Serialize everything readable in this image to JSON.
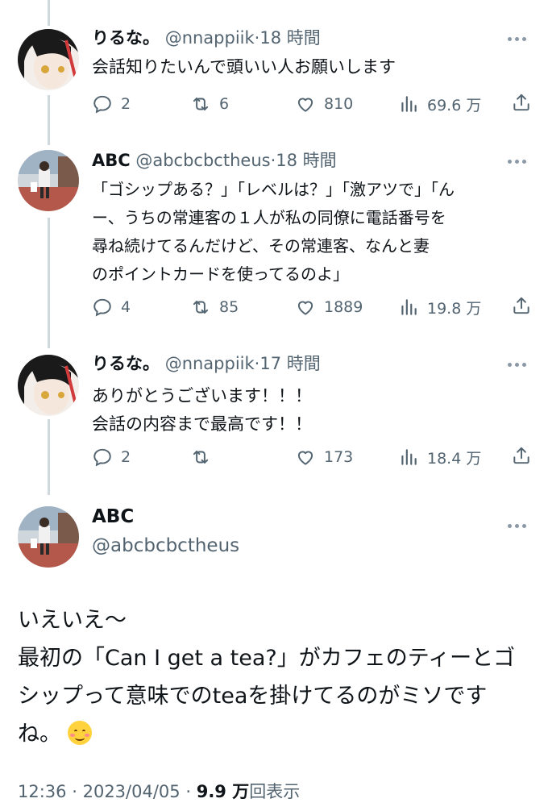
{
  "tweets": [
    {
      "name": "りるな。",
      "handle": "@nnappiik",
      "separator": "·",
      "time": "18 時間",
      "lines": [
        "会話知りたいんで頭いい人お願いします"
      ],
      "replies": "2",
      "retweets": "6",
      "likes": "810",
      "views": "69.6 万"
    },
    {
      "name": "ABC",
      "handle": "@abcbcbctheus",
      "separator": "·",
      "time": "18 時間",
      "lines": [
        "「ゴシップある？」「レベルは？」「激アツで」「ん",
        "ー、うちの常連客の１人が私の同僚に電話番号を",
        "尋ね続けてるんだけど、その常連客、なんと妻",
        "のポイントカードを使ってるのよ」"
      ],
      "replies": "4",
      "retweets": "85",
      "likes": "1889",
      "views": "19.8 万"
    },
    {
      "name": "りるな。",
      "handle": "@nnappiik",
      "separator": "·",
      "time": "17 時間",
      "lines": [
        "ありがとうございます！！！",
        "会話の内容まで最高です！！"
      ],
      "replies": "2",
      "retweets": "",
      "likes": "173",
      "views": "18.4 万"
    }
  ],
  "main": {
    "name": "ABC",
    "handle": "@abcbcbctheus",
    "lines": [
      "いえいえ〜",
      "最初の「Can I get a tea?」がカフェのティーとゴ",
      "シップって意味でのteaを掛けてるのがミソです",
      "ね。"
    ],
    "emoji": "smiling-face-emoji",
    "footer": {
      "time": "12:36",
      "separator": "·",
      "date": "2023/04/05",
      "separator2": "·",
      "views": "9.9 万",
      "views_label": "回表示"
    }
  }
}
